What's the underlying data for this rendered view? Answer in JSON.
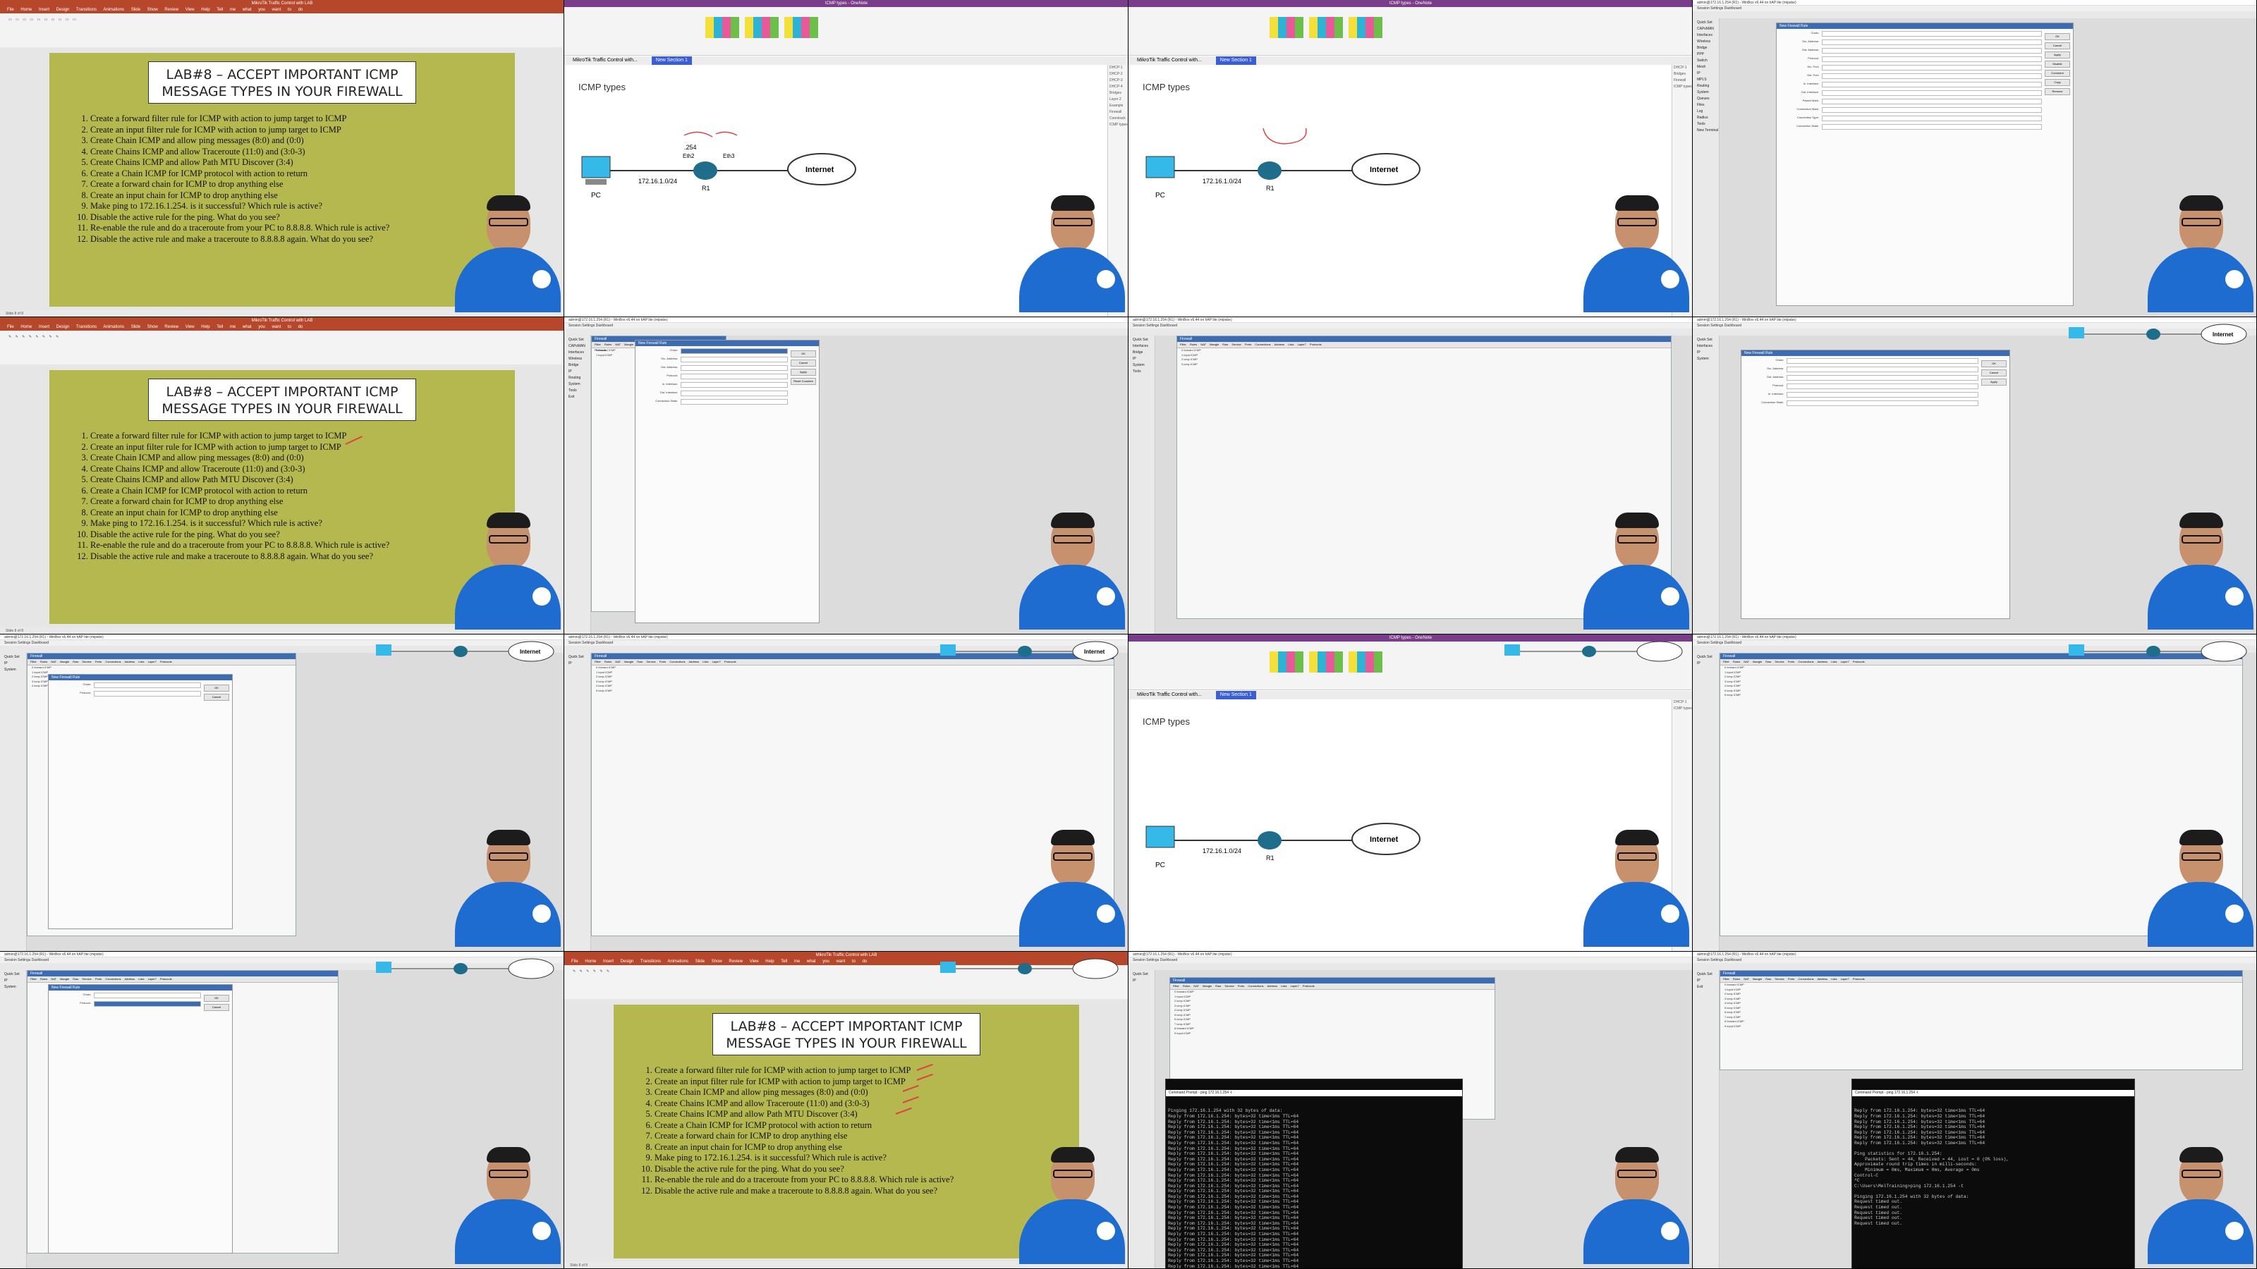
{
  "slide": {
    "title_line1": "LAB#8 – ACCEPT IMPORTANT ICMP",
    "title_line2": "MESSAGE TYPES IN YOUR FIREWALL",
    "steps": [
      "Create a forward filter rule for ICMP with action to jump target to ICMP",
      "Create an input filter rule for ICMP with action to jump target to ICMP",
      "Create Chain ICMP and allow ping messages (8:0) and (0:0)",
      "Create Chains ICMP and allow Traceroute (11:0) and (3:0-3)",
      "Create Chains ICMP and allow Path MTU Discover (3:4)",
      "Create a Chain ICMP for ICMP protocol with action to return",
      "Create a forward chain for ICMP to drop anything else",
      "Create an input chain for ICMP to drop anything else",
      "Make ping to 172.16.1.254. is it successful? Which rule is active?",
      "Disable the active rule for the ping. What do you see?",
      "Re-enable the rule and do a traceroute from your PC to 8.8.8.8. Which rule is active?",
      "Disable the active rule and make a traceroute to 8.8.8.8 again. What do you see?"
    ],
    "app_title": "MikroTik Traffic Control with LAB",
    "menu": "File Home Insert Design Transitions Animations Slide Show Review View Help Tell me what you want to do"
  },
  "onenote": {
    "app_title": "ICMP types - OneNote",
    "page_title": "ICMP types",
    "notebook": "MikroTik Traffic Control with...",
    "section": "New Section 1",
    "pc_label": "PC",
    "router_label": "R1",
    "internet_label": "Internet",
    "subnet": "172.16.1.0/24",
    "ip_254": ".254",
    "eth2": "Eth2",
    "eth3": "Eth3",
    "side_pages": [
      "DHCP-1",
      "DHCP-2",
      "DHCP-3",
      "DHCP-4",
      "Bridges",
      "Bridges",
      "Bridges",
      "Bridges",
      "Bridges",
      "Layer 2",
      "Example",
      "Example",
      "Example",
      "Firewall",
      "Firewall",
      "Firewall",
      "Firewall",
      "Firewall",
      "Conntrack",
      "Conntrack",
      "ICMP types"
    ]
  },
  "winbox": {
    "title": "admin@172.16.1.254 (R1) - WinBox v6.44 on hAP lite (mipsbe)",
    "menu": "Session Settings Dashboard",
    "sidebar": [
      "Quick Set",
      "CAPsMAN",
      "Interfaces",
      "Wireless",
      "Bridge",
      "PPP",
      "Switch",
      "Mesh",
      "IP",
      "MPLS",
      "Routing",
      "System",
      "Queues",
      "Files",
      "Log",
      "Radius",
      "Tools",
      "New Terminal",
      "Make Supout.rif",
      "Manual",
      "New WinBox",
      "Exit"
    ],
    "firewall_window": "Firewall",
    "firewall_tabs": "Filter Rules NAT Mangle Raw Service Ports Connections Address Lists Layer7 Protocols",
    "rule_rows": [
      "0  forward  ICMP",
      "1  input  ICMP",
      "2  icmp  ICMP",
      "3  icmp  ICMP",
      "4  icmp  ICMP",
      "5  icmp  ICMP",
      "6  icmp  ICMP",
      "7  icmp  ICMP",
      "8  forward  ICMP",
      "9  input  ICMP"
    ],
    "new_rule_title": "New Firewall Rule",
    "rule_tabs": "General Advanced Extra Action Statistics",
    "rule_fields": [
      "Chain:",
      "Src. Address:",
      "Dst. Address:",
      "Protocol:",
      "Src. Port:",
      "Dst. Port:",
      "Any. Port:",
      "In. Interface:",
      "Out. Interface:",
      "In. Interface List:",
      "Out. Interface List:",
      "Packet Mark:",
      "Connection Mark:",
      "Routing Mark:",
      "Routing Table:",
      "Connection Type:",
      "Connection State:",
      "Connection NAT State:"
    ],
    "rule_buttons": [
      "OK",
      "Cancel",
      "Apply",
      "Disable",
      "Comment",
      "Copy",
      "Remove",
      "Reset Counters",
      "Reset All Counters"
    ],
    "chain_value": "icmp",
    "status": "enabled"
  },
  "cmd": {
    "title": "Command Prompt - ping 172.16.1.254 -t",
    "ping_header": "Pinging 172.16.1.254 with 32 bytes of data:",
    "reply": "Reply from 172.16.1.254: bytes=32 time<1ms TTL=64",
    "stats_title": "Ping statistics for 172.16.1.254:",
    "stats_packets": "    Packets: Sent = 44, Received = 44, Lost = 0 (0% loss),",
    "stats_rtt": "Approximate round trip times in milli-seconds:",
    "stats_minmax": "    Minimum = 0ms, Maximum = 0ms, Average = 0ms",
    "ctrl_c": "Control-C",
    "prompt": "C:\\Users\\MelTraining>ping 172.16.1.254 -t",
    "timed_out": "Request timed out."
  },
  "ui_colors": {
    "ppt": "#b7472a",
    "onenote": "#7a3d8a",
    "slide": "#b4b84f",
    "winbox_header": "#3c6cb4",
    "arrow": "#d44444"
  },
  "icons": [
    "presenter-avatar",
    "pc-icon",
    "router-icon",
    "cloud-icon"
  ]
}
